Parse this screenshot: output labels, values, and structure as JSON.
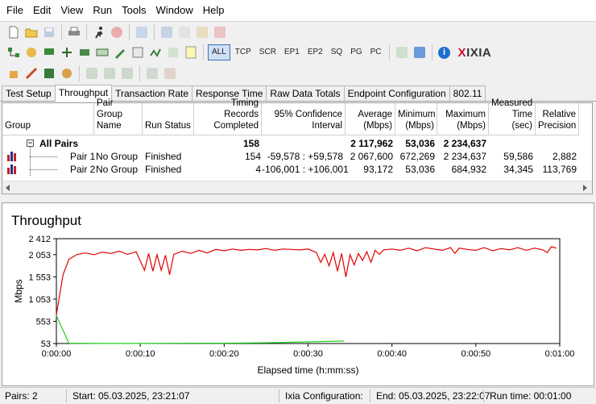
{
  "menu": [
    "File",
    "Edit",
    "View",
    "Run",
    "Tools",
    "Window",
    "Help"
  ],
  "toolbar": {
    "protocols": [
      "ALL",
      "TCP",
      "SCR",
      "EP1",
      "EP2",
      "SQ",
      "PG",
      "PC"
    ],
    "active_protocol": "ALL",
    "logo_mark": "X",
    "logo_text": "IXIA"
  },
  "tabs": [
    "Test Setup",
    "Throughput",
    "Transaction Rate",
    "Response Time",
    "Raw Data Totals",
    "Endpoint Configuration",
    "802.11"
  ],
  "active_tab": "Throughput",
  "table": {
    "headers": {
      "group": "Group",
      "pair_group_name": "Pair Group Name",
      "run_status": "Run Status",
      "timing_records": "Timing Records Completed",
      "confidence": "95% Confidence Interval",
      "average": "Average (Mbps)",
      "minimum": "Minimum (Mbps)",
      "maximum": "Maximum (Mbps)",
      "measured_time": "Measured Time (sec)",
      "relative_precision": "Relative Precision"
    },
    "all_pairs": {
      "group": "All Pairs",
      "timing_records": "158",
      "average": "2 117,962",
      "minimum": "53,036",
      "maximum": "2 234,637"
    },
    "rows": [
      {
        "group": "Pair 1",
        "pair_group_name": "No Group",
        "run_status": "Finished",
        "timing_records": "154",
        "confidence": "-59,578 : +59,578",
        "average": "2 067,600",
        "minimum": "672,269",
        "maximum": "2 234,637",
        "measured_time": "59,586",
        "relative_precision": "2,882"
      },
      {
        "group": "Pair 2",
        "pair_group_name": "No Group",
        "run_status": "Finished",
        "timing_records": "4",
        "confidence": "-106,001 : +106,001",
        "average": "93,172",
        "minimum": "53,036",
        "maximum": "684,932",
        "measured_time": "34,345",
        "relative_precision": "113,769"
      }
    ]
  },
  "chart_data": {
    "type": "line",
    "title": "Throughput",
    "xlabel": "Elapsed time (h:mm:ss)",
    "ylabel": "Mbps",
    "xlim": [
      0,
      60
    ],
    "ylim": [
      53,
      2412
    ],
    "yticks": [
      53,
      553,
      1053,
      1553,
      2053,
      2412
    ],
    "ytick_labels": [
      "53",
      "553",
      "1 053",
      "1 553",
      "2 053",
      "2 412"
    ],
    "xticks": [
      0,
      10,
      20,
      30,
      40,
      50,
      60
    ],
    "xtick_labels": [
      "0:00:00",
      "0:00:10",
      "0:00:20",
      "0:00:30",
      "0:00:40",
      "0:00:50",
      "0:01:00"
    ],
    "grid": false,
    "series": [
      {
        "color": "#e00000",
        "x": [
          0,
          0.8,
          1.5,
          2.5,
          3.5,
          4.5,
          5.5,
          6.5,
          7.5,
          8.5,
          9.5,
          10.5,
          11.0,
          11.5,
          12.0,
          12.5,
          13.0,
          13.5,
          14.0,
          15.0,
          16.0,
          17.0,
          18.0,
          19.0,
          20.0,
          21.0,
          22.0,
          23.0,
          24.0,
          25.0,
          26.0,
          27.0,
          28.0,
          29.0,
          30.0,
          31.0,
          31.5,
          32.0,
          32.5,
          33.0,
          33.5,
          34.0,
          34.5,
          35.0,
          35.5,
          36.0,
          36.5,
          37.0,
          37.5,
          38.0,
          38.5,
          39.0,
          40.0,
          41.0,
          42.0,
          43.0,
          44.0,
          45.0,
          46.0,
          47.0,
          47.5,
          48.0,
          49.0,
          50.0,
          51.0,
          52.0,
          53.0,
          54.0,
          55.0,
          56.0,
          57.0,
          58.0,
          58.5,
          59.0,
          59.6
        ],
        "values": [
          700,
          1600,
          1950,
          2060,
          2090,
          2050,
          2110,
          2080,
          2130,
          2060,
          2120,
          1700,
          2080,
          1680,
          2050,
          1700,
          2040,
          1600,
          2060,
          2130,
          2080,
          2150,
          2090,
          2170,
          2140,
          2180,
          2150,
          2170,
          2160,
          2190,
          2150,
          2180,
          2170,
          2160,
          2180,
          2100,
          1880,
          2060,
          1800,
          2100,
          1680,
          2080,
          1550,
          2050,
          1820,
          2080,
          1920,
          2120,
          1880,
          2150,
          2060,
          2160,
          2180,
          2150,
          2200,
          2140,
          2210,
          2180,
          2150,
          2210,
          2080,
          2200,
          2170,
          2150,
          2210,
          2140,
          2190,
          2160,
          2210,
          2150,
          2200,
          2160,
          2100,
          2230,
          2200
        ]
      },
      {
        "color": "#1fcf1f",
        "x": [
          0,
          1.5,
          5,
          10,
          15,
          20,
          25,
          30,
          34.3
        ],
        "values": [
          680,
          60,
          55,
          55,
          58,
          60,
          70,
          90,
          110
        ]
      }
    ]
  },
  "status": {
    "pairs": "Pairs: 2",
    "start": "Start: 05.03.2025, 23:21:07",
    "ixia_config": "Ixia Configuration:",
    "end": "End: 05.03.2025, 23:22:07",
    "run_time": "Run time: 00:01:00"
  }
}
